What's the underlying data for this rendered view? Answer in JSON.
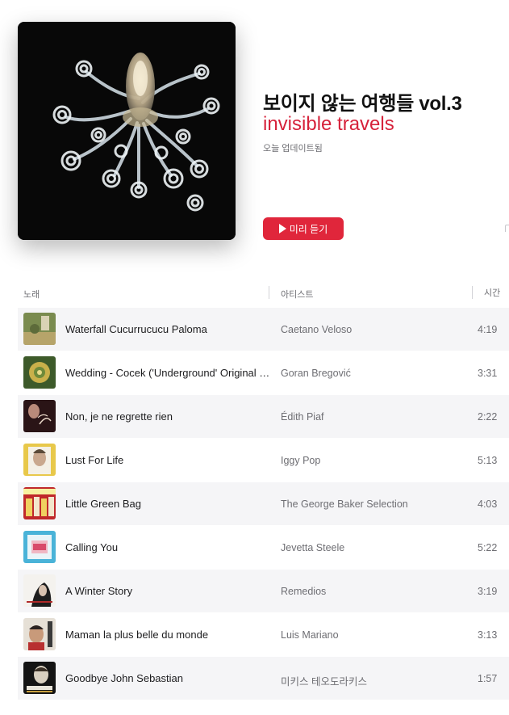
{
  "playlist": {
    "title": "보이지 않는 여행들 vol.3",
    "subtitle": "invisible travels",
    "updated": "오늘 업데이트됨",
    "preview_label": "미리 듣기"
  },
  "columns": {
    "song": "노래",
    "artist": "아티스트",
    "time": "시간"
  },
  "tracks": [
    {
      "title": "Waterfall Cucurrucucu Paloma",
      "artist": "Caetano Veloso",
      "time": "4:19"
    },
    {
      "title": "Wedding - Cocek ('Underground' Original Soundtrack)",
      "artist": "Goran Bregović",
      "time": "3:31"
    },
    {
      "title": "Non, je ne regrette rien",
      "artist": "Édith Piaf",
      "time": "2:22"
    },
    {
      "title": "Lust For Life",
      "artist": "Iggy Pop",
      "time": "5:13"
    },
    {
      "title": "Little Green Bag",
      "artist": "The George Baker Selection",
      "time": "4:03"
    },
    {
      "title": "Calling You",
      "artist": "Jevetta Steele",
      "time": "5:22"
    },
    {
      "title": "A Winter Story",
      "artist": "Remedios",
      "time": "3:19"
    },
    {
      "title": "Maman la plus belle du monde",
      "artist": "Luis Mariano",
      "time": "3:13"
    },
    {
      "title": "Goodbye John Sebastian",
      "artist": "미키스 테오도라키스",
      "time": "1:57"
    }
  ],
  "icons": {
    "preview": "play-icon"
  },
  "colors": {
    "accent": "#e0263b",
    "subtitle": "#d6213a"
  }
}
